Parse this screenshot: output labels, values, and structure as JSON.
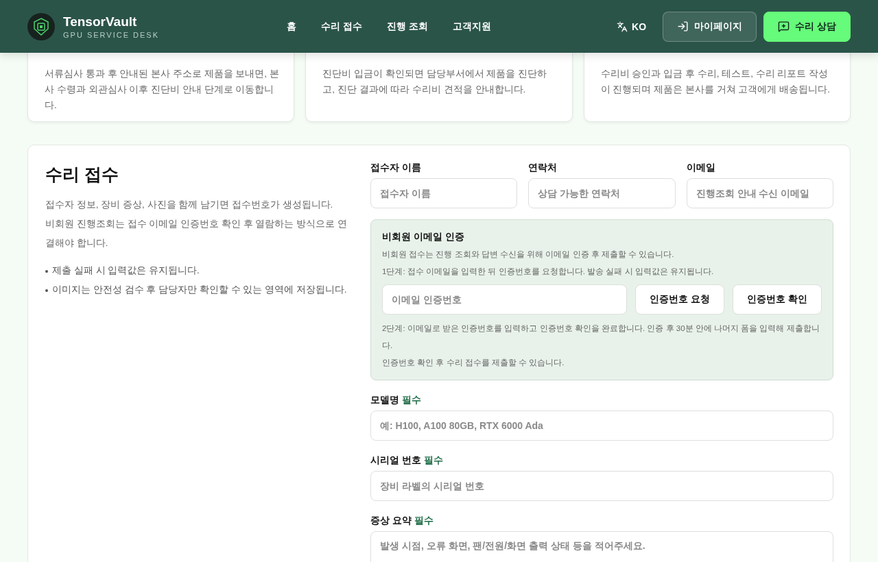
{
  "header": {
    "brand": "TensorVault",
    "tagline": "GPU SERVICE DESK",
    "nav": [
      {
        "label": "홈",
        "selected": false
      },
      {
        "label": "수리 접수",
        "selected": false
      },
      {
        "label": "진행 조회",
        "selected": false
      },
      {
        "label": "고객지원",
        "selected": false
      }
    ],
    "language": "KO",
    "mypage": "마이페이지",
    "consult": "수리 상담"
  },
  "steps": [
    {
      "text": "서류심사 통과 후 안내된 본사 주소로 제품을 보내면, 본사 수령과 외관심사 이후 진단비 안내 단계로 이동합니다."
    },
    {
      "text": "진단비 입금이 확인되면 담당부서에서 제품을 진단하고, 진단 결과에 따라 수리비 견적을 안내합니다."
    },
    {
      "text": "수리비 승인과 입금 후 수리, 테스트, 수리 리포트 작성이 진행되며 제품은 본사를 거쳐 고객에게 배송됩니다."
    }
  ],
  "intake": {
    "title": "수리 접수",
    "intro": [
      "접수자 정보, 장비 증상, 사진을 함께 남기면 접수번호가 생성됩니다.",
      "비회원 진행조회는 접수 이메일 인증번호 확인 후 열람하는 방식으로 연결해야 합니다."
    ],
    "notes": [
      "제출 실패 시 입력값은 유지됩니다.",
      "이미지는 안전성 검수 후 담당자만 확인할 수 있는 영역에 저장됩니다."
    ],
    "contact_fields": [
      {
        "label": "접수자 이름",
        "placeholder": "접수자 이름"
      },
      {
        "label": "연락처",
        "placeholder": "상담 가능한 연락처"
      },
      {
        "label": "이메일",
        "placeholder": "진행조회 안내 수신 이메일"
      }
    ],
    "verify": {
      "title": "비회원 이메일 인증",
      "desc": "비회원 접수는 진행 조회와 답변 수신을 위해 이메일 인증 후 제출할 수 있습니다.",
      "step1": "1단계: 접수 이메일을 입력한 뒤 인증번호를 요청합니다. 발송 실패 시 입력값은 유지됩니다.",
      "code_placeholder": "이메일 인증번호",
      "buttons": [
        "인증번호 요청",
        "인증번호 확인"
      ],
      "step2": "2단계: 이메일로 받은 인증번호를 입력하고 인증번호 확인을 완료합니다. 인증 후 30분 안에 나머지 폼을 입력해 제출합니다.",
      "status": "인증번호 확인 후 수리 접수를 제출할 수 있습니다."
    },
    "fields": [
      {
        "kind": "input",
        "label": "모델명",
        "required": "필수",
        "placeholder": "예: H100, A100 80GB, RTX 6000 Ada"
      },
      {
        "kind": "input",
        "label": "시리얼 번호",
        "required": "필수",
        "placeholder": "장비 라벨의 시리얼 번호"
      },
      {
        "kind": "textarea",
        "label": "증상 요약",
        "required": "필수",
        "placeholder": "발생 시점, 오류 화면, 팬/전원/화면 출력 상태 등을 적어주세요."
      }
    ]
  }
}
